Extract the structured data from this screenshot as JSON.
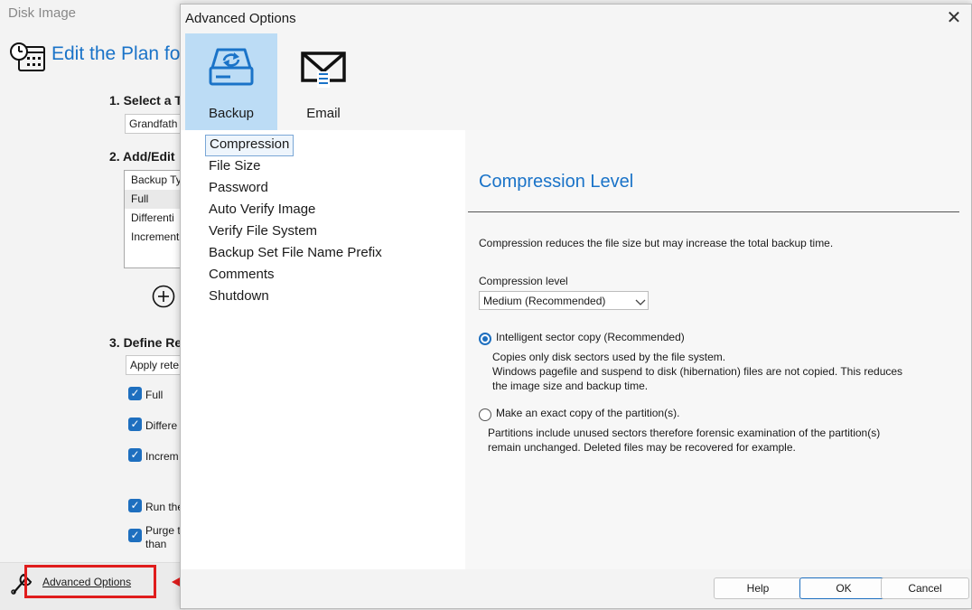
{
  "background_window": {
    "title": "Disk Image",
    "heading": "Edit the Plan for",
    "step1": "1. Select a T",
    "template_value": "Grandfath",
    "step2": "2. Add/Edit",
    "schedule_list": [
      "Backup Ty",
      "Full",
      "Differenti",
      "Increment"
    ],
    "step3": "3. Define Re",
    "retention_combo": "Apply rete",
    "checkboxes": [
      "Full",
      "Differe",
      "Increm",
      "Run the",
      "Purge t"
    ],
    "purge_second_line": "than",
    "advanced_options_link": "Advanced Options"
  },
  "dialog": {
    "title": "Advanced Options",
    "close_glyph": "✕",
    "tabs": [
      {
        "label": "Backup",
        "icon": "backup-drive-icon",
        "selected": true
      },
      {
        "label": "Email",
        "icon": "email-icon",
        "selected": false
      }
    ],
    "nav_items": [
      "Compression",
      "File Size",
      "Password",
      "Auto Verify Image",
      "Verify File System",
      "Backup Set File Name Prefix",
      "Comments",
      "Shutdown"
    ],
    "selected_nav": "Compression",
    "section_title": "Compression Level",
    "description": "Compression reduces the file size but may increase the total backup time.",
    "compression_level_label": "Compression level",
    "compression_level_value": "Medium (Recommended)",
    "options": [
      {
        "label": "Intelligent sector copy (Recommended)",
        "selected": true,
        "details": [
          "Copies only disk sectors used by the file system.",
          "Windows pagefile and suspend to disk (hibernation) files are not copied. This reduces",
          "the image size and backup time."
        ]
      },
      {
        "label": "Make an exact copy of the partition(s).",
        "selected": false,
        "details": [
          "Partitions include unused sectors therefore forensic examination of the partition(s)",
          "remain unchanged. Deleted files may be recovered for example."
        ]
      }
    ],
    "buttons": {
      "help": "Help",
      "ok": "OK",
      "cancel": "Cancel"
    }
  },
  "colors": {
    "accent": "#1a73c8",
    "highlight_red": "#e01c1c",
    "tab_selected": "#bcdcf5"
  }
}
